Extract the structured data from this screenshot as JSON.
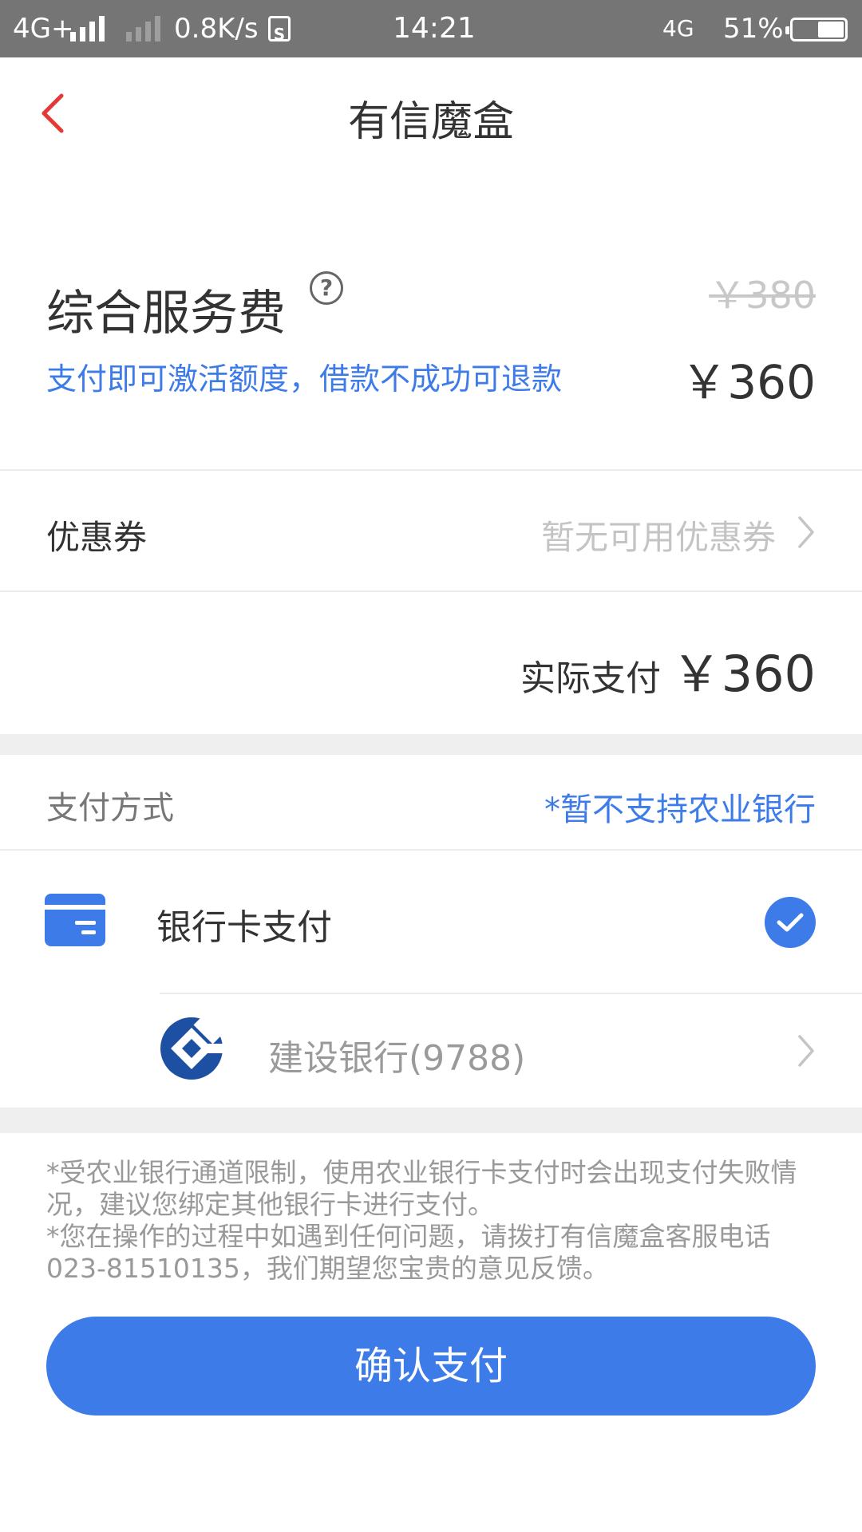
{
  "status_bar": {
    "network": "4G+",
    "speed": "0.8K/s",
    "sim": "S",
    "time": "14:21",
    "network2": "4G",
    "battery": "51%",
    "battery_level": 0.51
  },
  "nav": {
    "title": "有信魔盒",
    "back_icon": "chevron-left-icon"
  },
  "fee": {
    "title": "综合服务费",
    "help_symbol": "?",
    "original_price": "￥380",
    "subtitle": "支付即可激活额度，借款不成功可退款",
    "price": "￥360"
  },
  "coupon": {
    "label": "优惠券",
    "value": "暂无可用优惠券"
  },
  "actual": {
    "label": "实际支付",
    "price": "￥360"
  },
  "payment_method": {
    "label": "支付方式",
    "note": "*暂不支持农业银行"
  },
  "card_option": {
    "label": "银行卡支付",
    "selected": true
  },
  "bank": {
    "name": "建设银行(9788)"
  },
  "notes": {
    "line1": "*受农业银行通道限制，使用农业银行卡支付时会出现支付失败情况，建议您绑定其他银行卡进行支付。",
    "line2": "*您在操作的过程中如遇到任何问题，请拨打有信魔盒客服电话023-81510135，我们期望您宝贵的意见反馈。"
  },
  "confirm_button": "确认支付",
  "colors": {
    "accent": "#3d7be8",
    "back": "#e53935",
    "status_bar": "#757575"
  }
}
